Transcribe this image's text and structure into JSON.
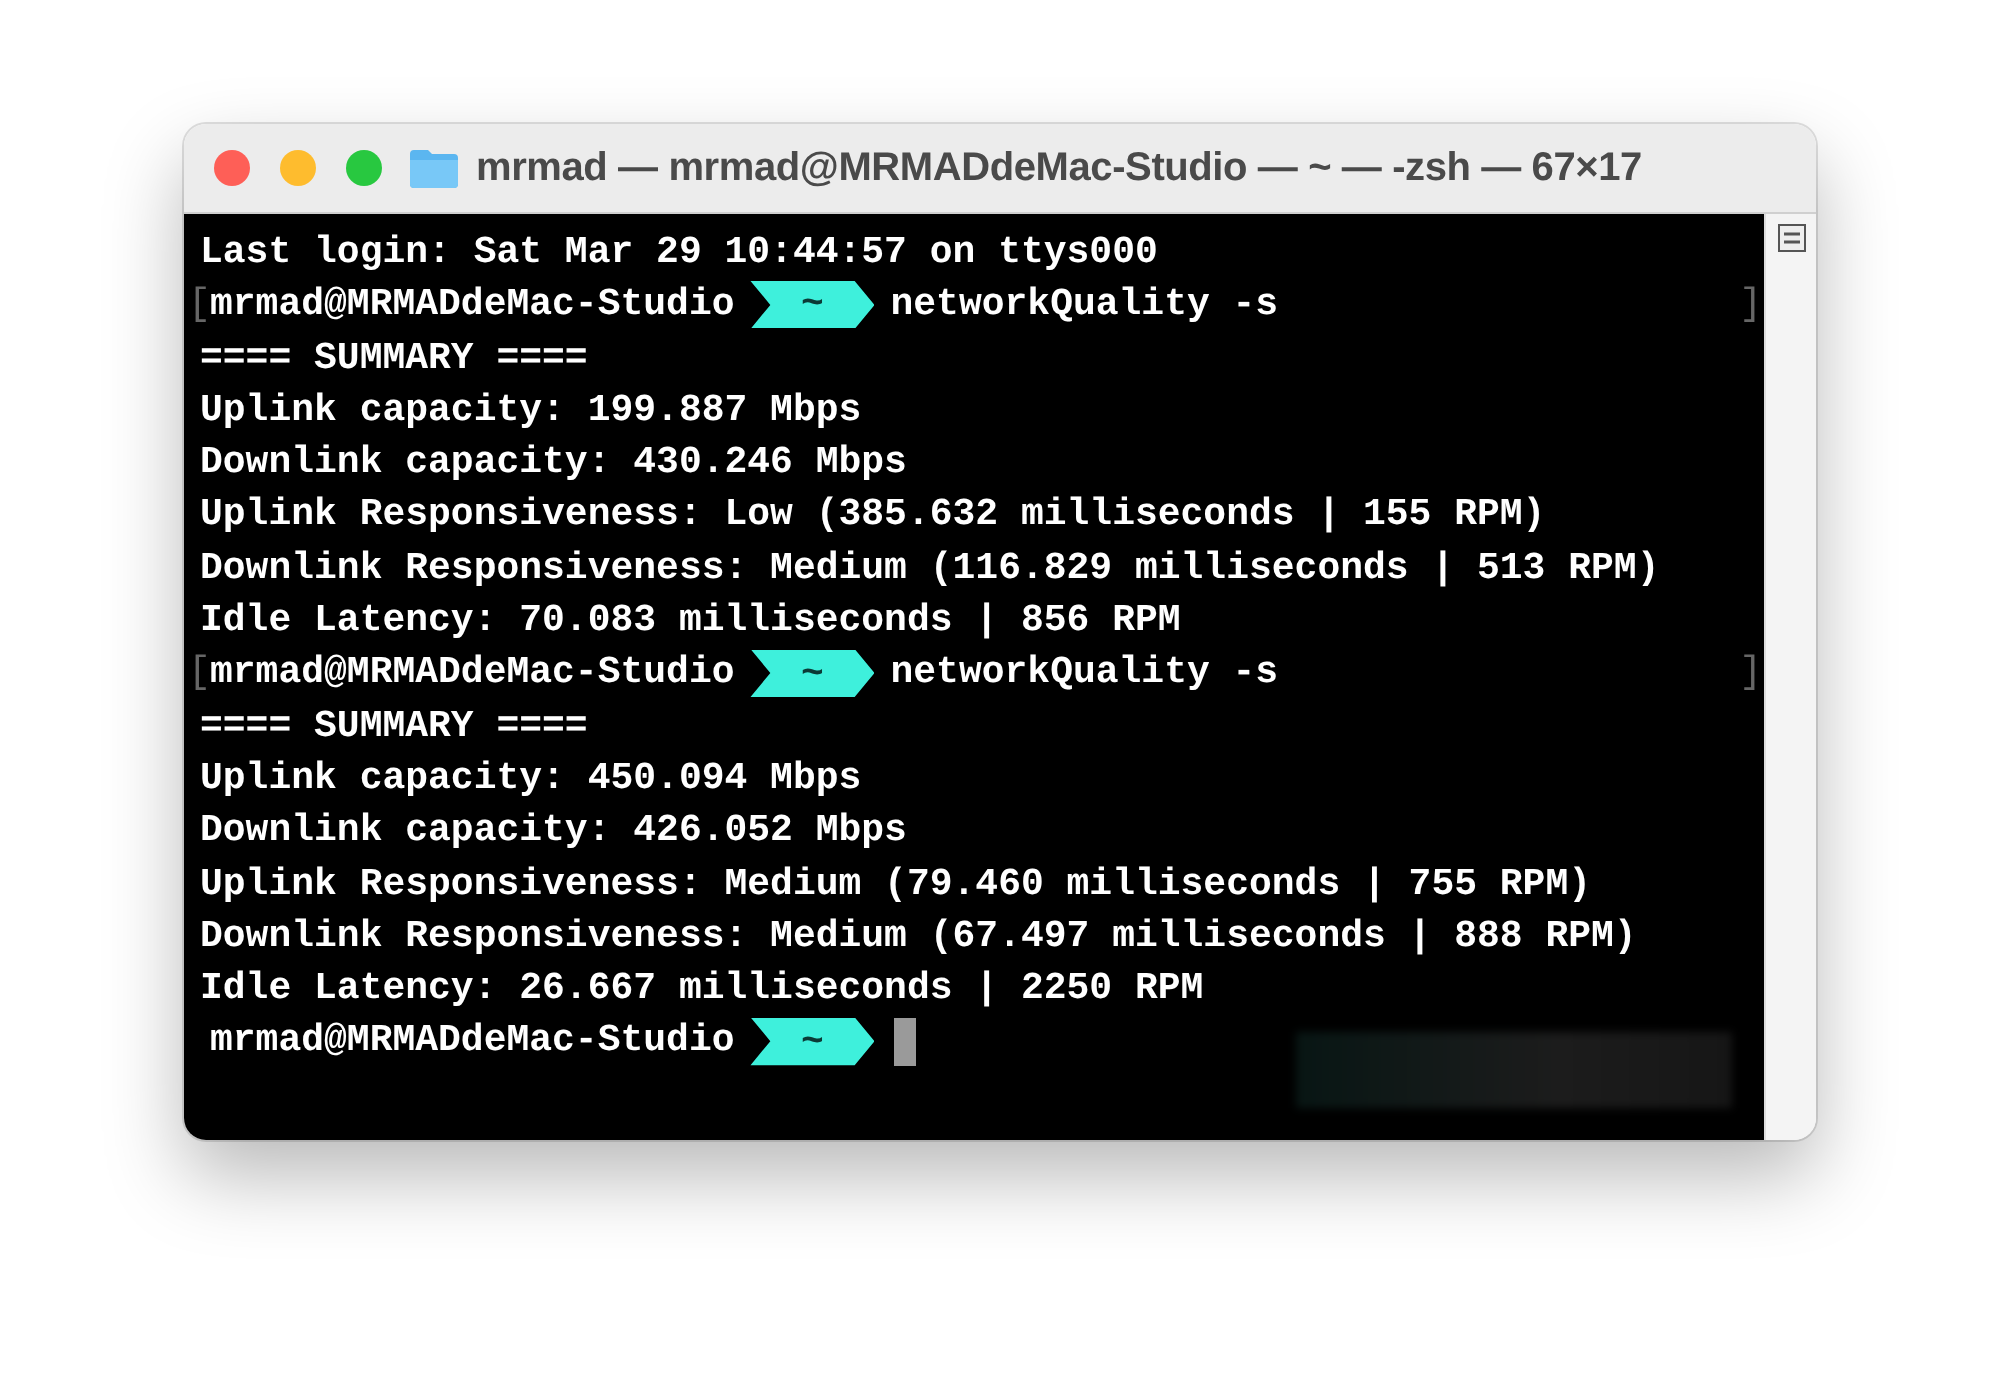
{
  "window": {
    "title": "mrmad — mrmad@MRMADdeMac-Studio — ~ — -zsh — 67×17"
  },
  "terminal": {
    "lines": [
      {
        "kind": "text",
        "text": "Last login: Sat Mar 29 10:44:57 on ttys000"
      },
      {
        "kind": "prompt",
        "open_bracket": "[",
        "close_bracket": "]",
        "user": "mrmad@MRMADdeMac-Studio",
        "dir": "~",
        "command": "networkQuality -s",
        "cursor": false
      },
      {
        "kind": "text",
        "text": "==== SUMMARY ===="
      },
      {
        "kind": "text",
        "text": "Uplink capacity: 199.887 Mbps"
      },
      {
        "kind": "text",
        "text": "Downlink capacity: 430.246 Mbps"
      },
      {
        "kind": "text",
        "text": "Uplink Responsiveness: Low (385.632 milliseconds | 155 RPM)"
      },
      {
        "kind": "text",
        "text": "Downlink Responsiveness: Medium (116.829 milliseconds | 513 RPM)"
      },
      {
        "kind": "text",
        "text": "Idle Latency: 70.083 milliseconds | 856 RPM"
      },
      {
        "kind": "prompt",
        "open_bracket": "[",
        "close_bracket": "]",
        "user": "mrmad@MRMADdeMac-Studio",
        "dir": "~",
        "command": "networkQuality -s",
        "cursor": false
      },
      {
        "kind": "text",
        "text": "==== SUMMARY ===="
      },
      {
        "kind": "text",
        "text": "Uplink capacity: 450.094 Mbps"
      },
      {
        "kind": "text",
        "text": "Downlink capacity: 426.052 Mbps"
      },
      {
        "kind": "text",
        "text": "Uplink Responsiveness: Medium (79.460 milliseconds | 755 RPM)"
      },
      {
        "kind": "text",
        "text": "Downlink Responsiveness: Medium (67.497 milliseconds | 888 RPM)"
      },
      {
        "kind": "text",
        "text": "Idle Latency: 26.667 milliseconds | 2250 RPM"
      },
      {
        "kind": "prompt",
        "user": "mrmad@MRMADdeMac-Studio",
        "dir": "~",
        "cursor": true
      }
    ]
  }
}
